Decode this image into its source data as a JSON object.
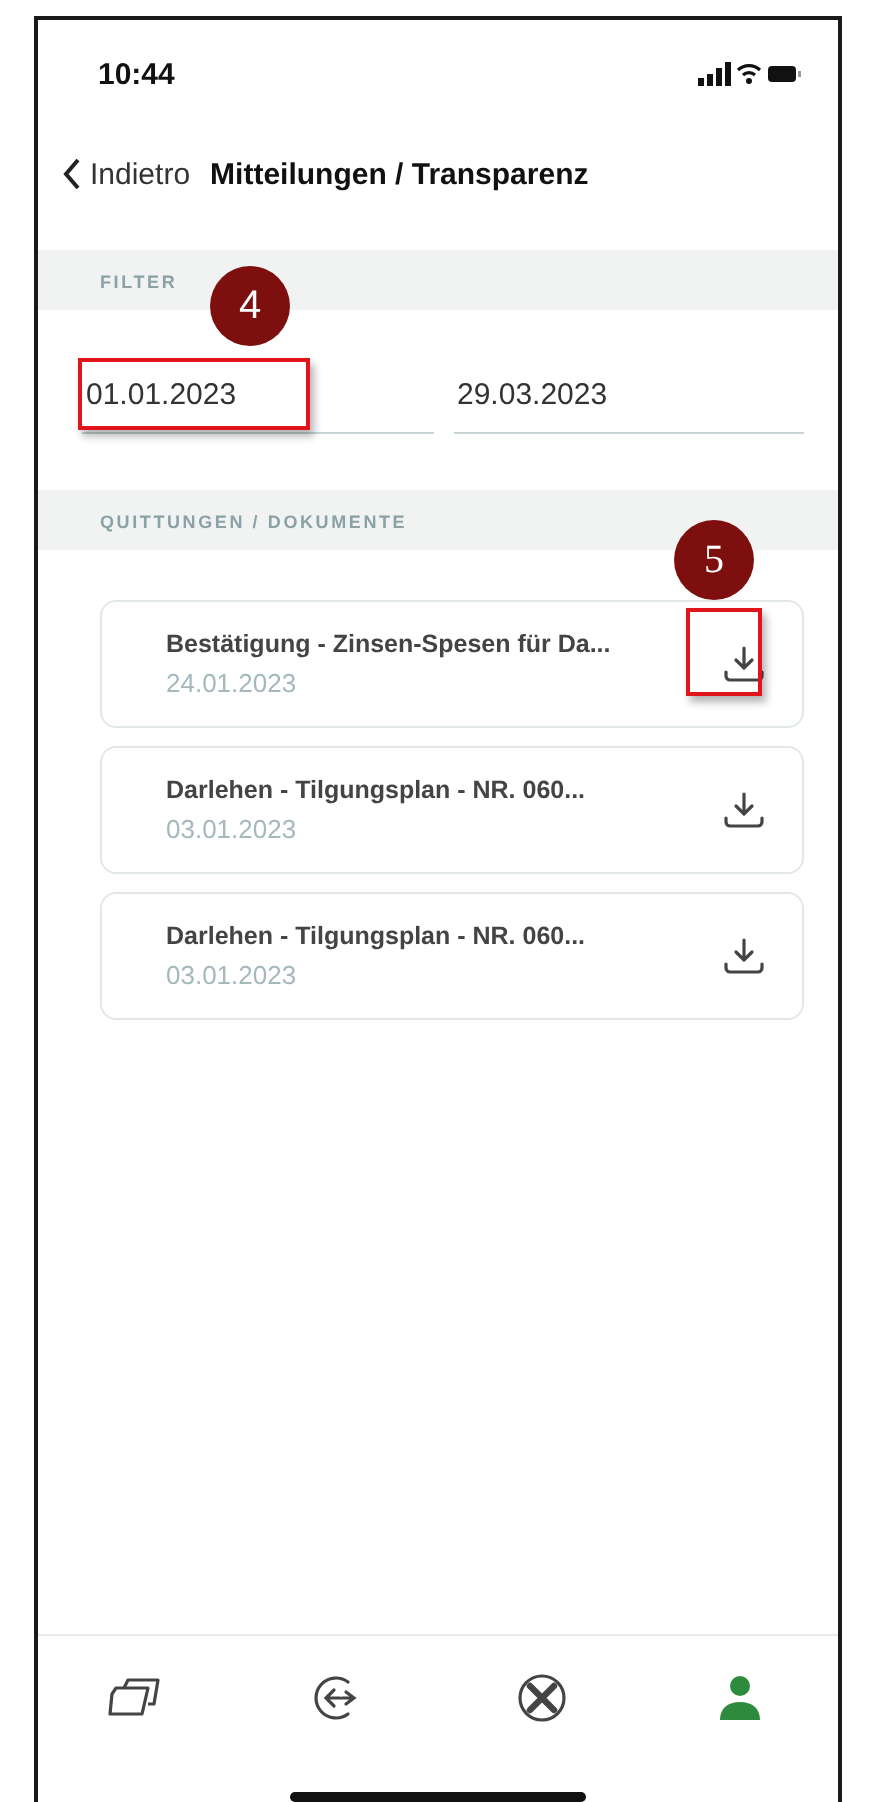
{
  "status_bar": {
    "time": "10:44"
  },
  "nav": {
    "back_label": "Indietro",
    "title": "Mitteilungen / Transparenz"
  },
  "filter": {
    "header": "FILTER",
    "date_from": {
      "value": "01.01.2023",
      "callout": "4"
    },
    "date_to": {
      "value": "29.03.2023"
    }
  },
  "documents": {
    "header": "QUITTUNGEN / DOKUMENTE",
    "items": [
      {
        "title": "Bestätigung - Zinsen-Spesen für Da...",
        "date": "24.01.2023",
        "callout": "5"
      },
      {
        "title": "Darlehen - Tilgungsplan - NR. 060...",
        "date": "03.01.2023"
      },
      {
        "title": "Darlehen - Tilgungsplan - NR. 060...",
        "date": "03.01.2023"
      }
    ]
  },
  "tab_bar": [
    {
      "kind": "cards",
      "selected": false
    },
    {
      "kind": "transfer",
      "selected": false
    },
    {
      "kind": "tools",
      "selected": false
    },
    {
      "kind": "profile",
      "selected": true
    }
  ]
}
